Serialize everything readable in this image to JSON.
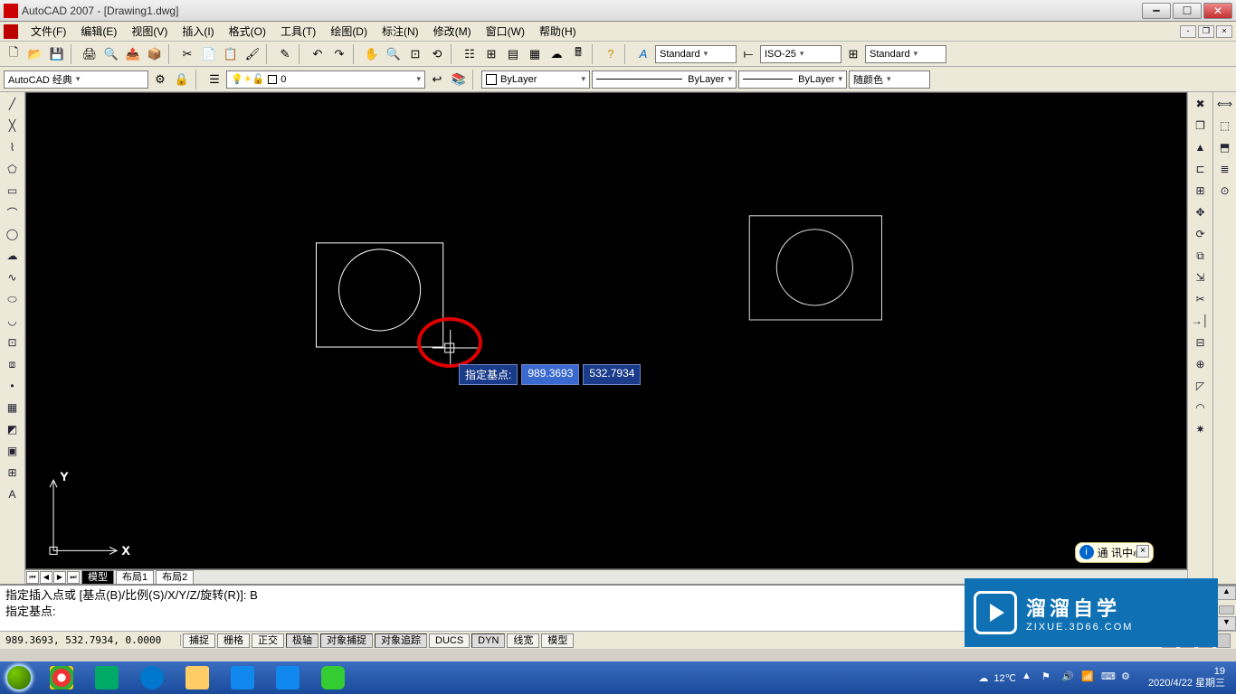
{
  "title": "AutoCAD 2007 - [Drawing1.dwg]",
  "menus": [
    "文件(F)",
    "编辑(E)",
    "视图(V)",
    "插入(I)",
    "格式(O)",
    "工具(T)",
    "绘图(D)",
    "标注(N)",
    "修改(M)",
    "窗口(W)",
    "帮助(H)"
  ],
  "workspace": "AutoCAD 经典",
  "layer_current": "0",
  "style_text": "Standard",
  "dim_style": "ISO-25",
  "table_style": "Standard",
  "prop_bylayer1": "ByLayer",
  "prop_bylayer2": "ByLayer",
  "prop_bylayer3": "ByLayer",
  "color_combo": "随颜色",
  "model_tabs": {
    "active": "模型",
    "others": [
      "布局1",
      "布局2"
    ]
  },
  "help_bubble": "通 讯中心",
  "cmd_line1": "指定插入点或 [基点(B)/比例(S)/X/Y/Z/旋转(R)]: B",
  "cmd_line2": "指定基点:",
  "dyn_label": "指定基点:",
  "dyn_x": "989.3693",
  "dyn_y": "532.7934",
  "status_coords": "989.3693, 532.7934, 0.0000",
  "status_toggles": [
    "捕捉",
    "栅格",
    "正交",
    "极轴",
    "对象捕捉",
    "对象追踪",
    "DUCS",
    "DYN",
    "线宽",
    "模型"
  ],
  "tray_temp": "12℃",
  "tray_time": "19",
  "tb_date": "2020/4/22 星期三",
  "watermark": {
    "big": "溜溜自学",
    "small": "ZIXUE.3D66.COM"
  }
}
